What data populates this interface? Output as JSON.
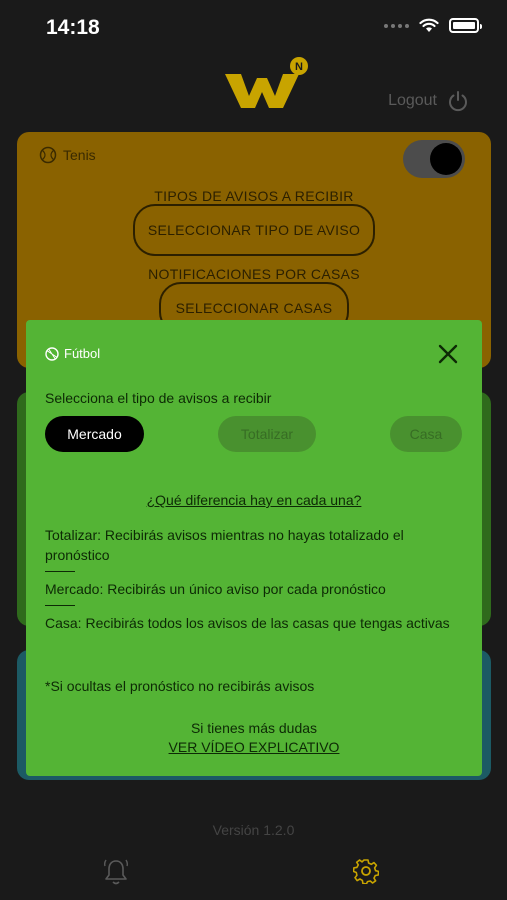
{
  "status_bar": {
    "time": "14:18"
  },
  "header": {
    "logout_label": "Logout"
  },
  "cards": {
    "tenis": {
      "title": "Tenis",
      "toggle_on": true,
      "alerts_label": "TIPOS DE AVISOS A RECIBIR",
      "alerts_button": "SELECCIONAR TIPO DE AVISO",
      "houses_label": "NOTIFICACIONES POR CASAS",
      "houses_button": "SELECCIONAR CASAS"
    }
  },
  "modal": {
    "sport": "Fútbol",
    "prompt": "Selecciona el tipo de avisos a recibir",
    "options": [
      {
        "label": "Mercado",
        "selected": true
      },
      {
        "label": "Totalizar",
        "selected": false
      },
      {
        "label": "Casa",
        "selected": false
      }
    ],
    "difference_link": "¿Qué diferencia hay en cada una?",
    "descriptions": {
      "totalizar": "Totalizar: Recibirás avisos mientras no hayas totalizado el pronóstico",
      "mercado": "Mercado: Recibirás un único aviso por cada pronóstico",
      "casa": "Casa: Recibirás todos los avisos de las casas que tengas activas"
    },
    "note": "*Si ocultas el pronóstico no recibirás avisos",
    "more_doubts": "Si tienes más dudas",
    "video_link": "VER VÍDEO EXPLICATIVO"
  },
  "footer": {
    "version": "Versión 1.2.0"
  },
  "colors": {
    "modal_bg": "#54b435",
    "tenis_card": "#8a6200",
    "logo": "#c8a400",
    "gear_active": "#c8a400"
  }
}
